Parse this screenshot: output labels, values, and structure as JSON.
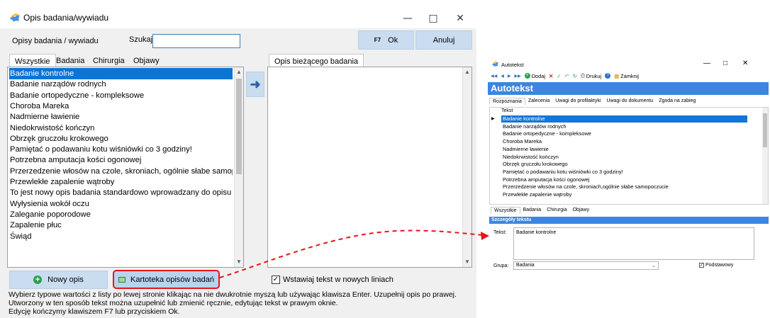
{
  "main": {
    "title": "Opis badania/wywiadu",
    "header_label": "Opisy badania / wywiadu",
    "search_label": "Szukaj:",
    "search_value": "",
    "ok_shortcut": "F7",
    "ok_label": "Ok",
    "cancel_label": "Anuluj",
    "tabs": [
      "Wszystkie",
      "Badania",
      "Chirurgia",
      "Objawy"
    ],
    "active_tab": 0,
    "items": [
      "Badanie kontrolne",
      "Badanie narządów rodnych",
      "Badanie ortopedyczne - kompleksowe",
      "Choroba Mareka",
      "Nadmierne ławienie",
      "Niedokrwistość kończyn",
      "Obrzęk gruczołu krokowego",
      "Pamiętać o podawaniu kotu wiśniówki co 3 godziny!",
      "Potrzebna amputacja kości ogonowej",
      "Przerzedzenie włosów na czole, skroniach,  ogólnie słabe samopoczucie",
      "Przewlekłe zapalenie wątroby",
      "To jest nowy opis badania standardowo wprowadzany do opisu badania",
      "Wyłysienia wokół oczu",
      "Zaleganie poporodowe",
      "Zapalenie płuc",
      "Świąd"
    ],
    "selected_index": 0,
    "current_tab": "Opis bieżącego badania",
    "current_value": "",
    "new_label": "Nowy opis",
    "catalog_label": "Kartoteka opisów badań",
    "checkbox_label": "Wstawiaj tekst w nowych liniach",
    "checkbox_checked": true,
    "help": [
      "Wybierz typowe wartości z listy po lewej stronie klikając na nie dwukrotnie myszą lub używając klawisza Enter. Uzupełnij opis po prawej.",
      "Utworzony w ten sposób tekst można uzupełnić lub zmienić ręcznie, edytując tekst w prawym oknie.",
      "Edycję kończymy klawiszem F7 lub przyciskiem Ok."
    ]
  },
  "autotekst": {
    "window_title": "Autotekst",
    "toolbar": {
      "add": "Dodaj",
      "print": "Drukuj",
      "close": "Zamknij"
    },
    "header": "Autotekst",
    "tabs": [
      "Rozpoznania",
      "Zalecenia",
      "Uwagi do profilaktyki",
      "Uwagi do dokumentu",
      "Zgoda na zabieg"
    ],
    "column": "Tekst",
    "items": [
      "Badanie kontrolne",
      "Badanie narządów rodnych",
      "Badanie ortopedyczne - kompleksowe",
      "Choroba Mareka",
      "Nadmierne ławienie",
      "Niedokrwistość kończyn",
      "Obrzęk gruczołu krokowego",
      "Pamiętać o podawaniu kotu wiśniówki co 3 godziny!",
      "Potrzebna amputacja kości ogonowej",
      "Przerzedzenie włosów na czole, skroniach,ogólnie słabe samopoczucie",
      "Przewlekłe zapalenie wątroby"
    ],
    "bottom_tabs": [
      "Wszystkie",
      "Badania",
      "Chirurgia",
      "Objawy"
    ],
    "details_header": "Szczegóły tekstu",
    "text_label": "Tekst:",
    "text_value": "Badanie kontrolne",
    "group_label": "Grupa:",
    "group_value": "Badania",
    "basic_label": "Podstawowy",
    "basic_checked": true
  },
  "colors": {
    "selection": "#0a75d6",
    "button": "#c9dcf0",
    "annotation": "#e8141c",
    "header_blue": "#3a86e0"
  }
}
